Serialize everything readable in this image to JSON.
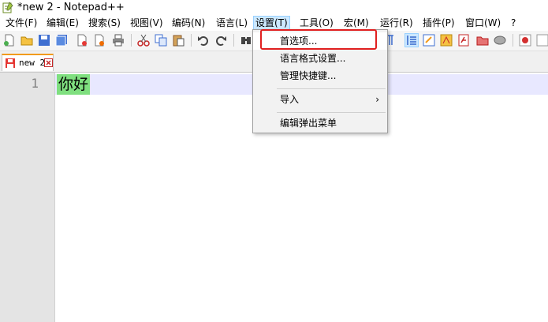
{
  "window": {
    "title": "*new 2 - Notepad++"
  },
  "menubar": {
    "items": [
      {
        "label": "文件(F)"
      },
      {
        "label": "编辑(E)"
      },
      {
        "label": "搜索(S)"
      },
      {
        "label": "视图(V)"
      },
      {
        "label": "编码(N)"
      },
      {
        "label": "语言(L)"
      },
      {
        "label": "设置(T)"
      },
      {
        "label": "工具(O)"
      },
      {
        "label": "宏(M)"
      },
      {
        "label": "运行(R)"
      },
      {
        "label": "插件(P)"
      },
      {
        "label": "窗口(W)"
      },
      {
        "label": "?"
      }
    ],
    "active_index": 6
  },
  "tabs": [
    {
      "label": "new 2"
    }
  ],
  "editor": {
    "line_number": "1",
    "text": "你好"
  },
  "settings_menu": {
    "items": [
      {
        "label": "首选项..."
      },
      {
        "label": "语言格式设置..."
      },
      {
        "label": "管理快捷键..."
      },
      {
        "label": "导入",
        "submenu_arrow": "›"
      },
      {
        "label": "编辑弹出菜单"
      }
    ]
  },
  "colors": {
    "highlight_box": "#e02020",
    "active_tab_accent": "#f29b1c",
    "selection": "#7fdf7f",
    "current_line": "#e8e8ff"
  }
}
